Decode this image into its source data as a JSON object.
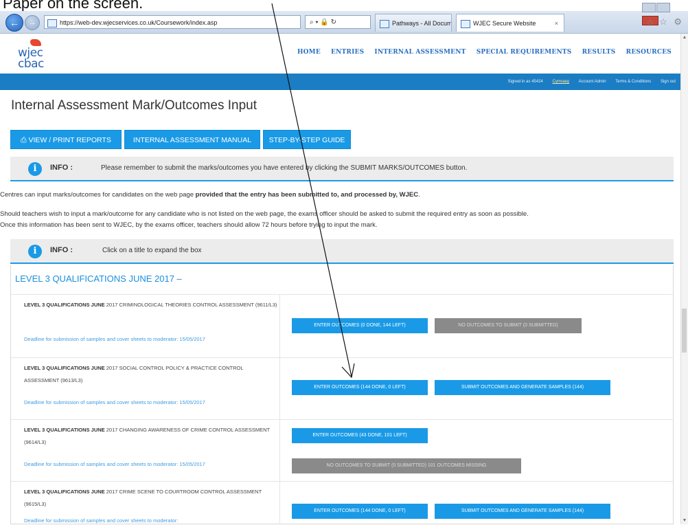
{
  "caption": "Paper on the screen.",
  "browser": {
    "back_icon": "back-arrow-icon",
    "url": "https://web-dev.wjecservices.co.uk/Coursework/index.asp",
    "search_controls": "⌕ ▾ 🔒 ↻",
    "tabs": [
      {
        "label": "Pathways - All Documents",
        "active": false
      },
      {
        "label": "WJEC Secure Website",
        "active": true
      }
    ],
    "tab_close": "×",
    "right_icons": "⌂ ☆ ⚙"
  },
  "site": {
    "logo_line1": "wjec",
    "logo_line2": "cbac",
    "nav": [
      "HOME",
      "ENTRIES",
      "INTERNAL ASSESSMENT",
      "SPECIAL REQUIREMENTS",
      "RESULTS",
      "RESOURCES"
    ],
    "user_bar": {
      "signed_in": "Signed in as 45424",
      "lang": "Cymraeg",
      "account": "Account Admin",
      "terms": "Terms & Conditions",
      "signout": "Sign out"
    }
  },
  "page": {
    "title": "Internal Assessment Mark/Outcomes Input",
    "buttons": {
      "view_print": "⎙ VIEW / PRINT REPORTS",
      "manual": "INTERNAL ASSESSMENT MANUAL",
      "guide": "STEP-BY-STEP GUIDE"
    },
    "info1": {
      "label": "INFO :",
      "text": "Please remember to submit the marks/outcomes you have entered by clicking the SUBMIT MARKS/OUTCOMES button."
    },
    "para1_pre": "Centres can input marks/outcomes for candidates on the web page ",
    "para1_bold": "provided that the entry has been submitted to, and processed by, WJEC",
    "para1_post": ".",
    "para2": "Should teachers wish to input a mark/outcome for any candidate who is not listed on the web page, the exams officer should be asked to submit the required entry as soon as possible.",
    "para3": "Once this information has been sent to WJEC, by the exams officer, teachers should allow 72 hours before trying to input the mark.",
    "info2": {
      "label": "INFO :",
      "text": "Click on a title to expand the box"
    },
    "qual_title": "LEVEL 3 QUALIFICATIONS JUNE 2017 –",
    "qualifications": [
      {
        "name_bold": "LEVEL 3 QUALIFICATIONS JUNE",
        "name_rest": " 2017 CRIMINOLOGICAL THEORIES CONTROL ASSESSMENT (9611/L3)",
        "deadline": "Deadline for submission of samples and cover sheets to moderator: 15/05/2017",
        "btn1": "ENTER OUTCOMES (0 DONE, 144 LEFT)",
        "btn2": "NO OUTCOMES TO SUBMIT (0 SUBMITTED)"
      },
      {
        "name_bold": "LEVEL 3 QUALIFICATIONS JUNE",
        "name_rest": " 2017 SOCIAL CONTROL POLICY & PRACTICE CONTROL ASSESSMENT (9613/L3)",
        "deadline": "Deadline for submission of samples and cover sheets to moderator: 15/05/2017",
        "btn1": "ENTER OUTCOMES (144 DONE, 0 LEFT)",
        "btn2": "SUBMIT OUTCOMES AND GENERATE SAMPLES (144)"
      },
      {
        "name_bold": "LEVEL 3 QUALIFICATIONS JUNE",
        "name_rest": " 2017 CHANGING AWARENESS OF CRIME CONTROL ASSESSMENT (9614/L3)",
        "deadline": "Deadline for submission of samples and cover sheets to moderator: 15/05/2017",
        "btn1": "ENTER OUTCOMES (43 DONE, 101 LEFT)",
        "btn2": "NO OUTCOMES TO SUBMIT (0 SUBMITTED) 101 OUTCOMES MISSING"
      },
      {
        "name_bold": "LEVEL 3 QUALIFICATIONS JUNE",
        "name_rest": " 2017 CRIME SCENE TO COURTROOM CONTROL ASSESSMENT (9615/L3)",
        "deadline": "Deadline for submission of samples and cover sheets to moderator:",
        "btn1": "ENTER OUTCOMES (144 DONE, 0 LEFT)",
        "btn2": "SUBMIT OUTCOMES AND GENERATE SAMPLES (144)"
      }
    ]
  },
  "colors": {
    "brand_blue": "#1a9ae6",
    "bar_blue": "#1b7dc3",
    "grey_button": "#8a8a8a",
    "link_blue": "#3f9be0"
  }
}
